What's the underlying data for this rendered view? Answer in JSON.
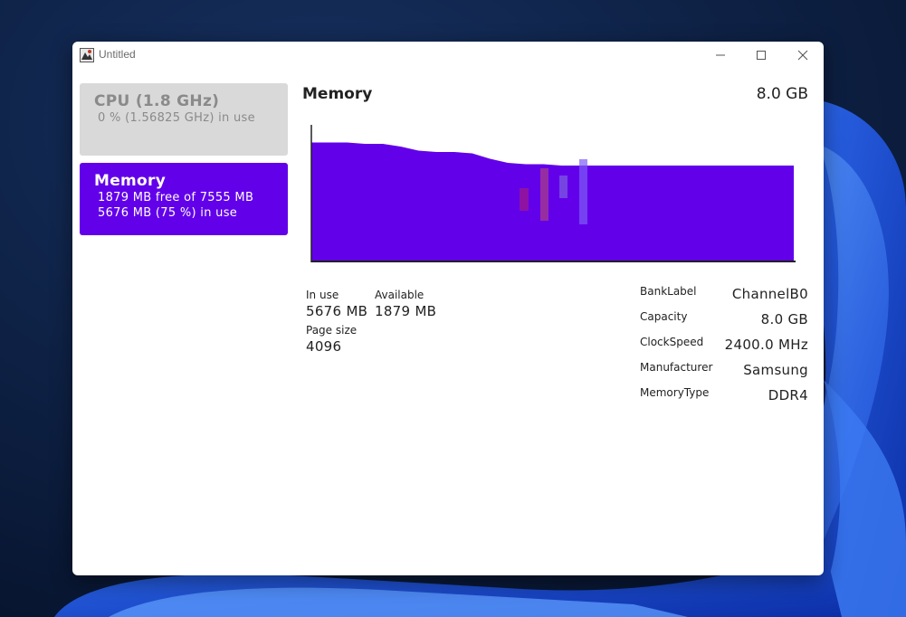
{
  "window": {
    "title": "Untitled"
  },
  "sidebar": {
    "cpu": {
      "title": "CPU (1.8 GHz)",
      "usage": "0 % (1.56825 GHz) in use"
    },
    "memory": {
      "title": "Memory",
      "free": "1879 MB free of 7555 MB",
      "usage": "5676 MB (75 %) in use"
    }
  },
  "panel": {
    "title": "Memory",
    "total": "8.0 GB",
    "stats": {
      "in_use_label": "In use",
      "in_use_value": "5676 MB",
      "available_label": "Available",
      "available_value": "1879 MB",
      "page_size_label": "Page size",
      "page_size_value": "4096"
    },
    "info": [
      {
        "key": "BankLabel",
        "value": "ChannelB0"
      },
      {
        "key": "Capacity",
        "value": "8.0 GB"
      },
      {
        "key": "ClockSpeed",
        "value": "2400.0 MHz"
      },
      {
        "key": "Manufacturer",
        "value": "Samsung"
      },
      {
        "key": "MemoryType",
        "value": "DDR4"
      }
    ]
  },
  "chart_data": {
    "type": "area",
    "fill_color": "#6200ea",
    "axis_color": "#222222",
    "usage_fraction": [
      0.87,
      0.87,
      0.87,
      0.86,
      0.86,
      0.84,
      0.81,
      0.8,
      0.8,
      0.79,
      0.75,
      0.72,
      0.71,
      0.71,
      0.7,
      0.7,
      0.7,
      0.7,
      0.7,
      0.7,
      0.7,
      0.7,
      0.7,
      0.7,
      0.7,
      0.7,
      0.7,
      0.7
    ]
  }
}
